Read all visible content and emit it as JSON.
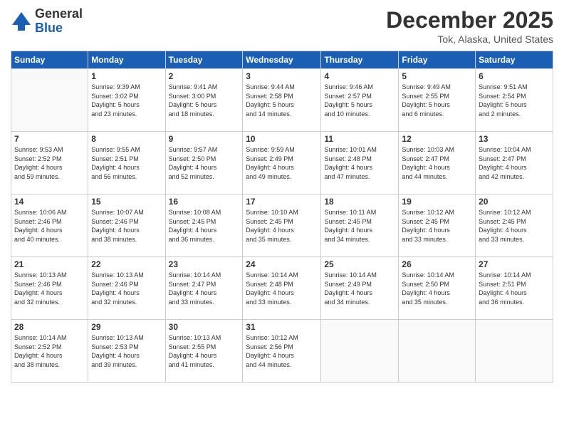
{
  "logo": {
    "general": "General",
    "blue": "Blue"
  },
  "header": {
    "month": "December 2025",
    "location": "Tok, Alaska, United States"
  },
  "weekdays": [
    "Sunday",
    "Monday",
    "Tuesday",
    "Wednesday",
    "Thursday",
    "Friday",
    "Saturday"
  ],
  "weeks": [
    [
      {
        "day": "",
        "info": ""
      },
      {
        "day": "1",
        "info": "Sunrise: 9:39 AM\nSunset: 3:02 PM\nDaylight: 5 hours\nand 23 minutes."
      },
      {
        "day": "2",
        "info": "Sunrise: 9:41 AM\nSunset: 3:00 PM\nDaylight: 5 hours\nand 18 minutes."
      },
      {
        "day": "3",
        "info": "Sunrise: 9:44 AM\nSunset: 2:58 PM\nDaylight: 5 hours\nand 14 minutes."
      },
      {
        "day": "4",
        "info": "Sunrise: 9:46 AM\nSunset: 2:57 PM\nDaylight: 5 hours\nand 10 minutes."
      },
      {
        "day": "5",
        "info": "Sunrise: 9:49 AM\nSunset: 2:55 PM\nDaylight: 5 hours\nand 6 minutes."
      },
      {
        "day": "6",
        "info": "Sunrise: 9:51 AM\nSunset: 2:54 PM\nDaylight: 5 hours\nand 2 minutes."
      }
    ],
    [
      {
        "day": "7",
        "info": "Sunrise: 9:53 AM\nSunset: 2:52 PM\nDaylight: 4 hours\nand 59 minutes."
      },
      {
        "day": "8",
        "info": "Sunrise: 9:55 AM\nSunset: 2:51 PM\nDaylight: 4 hours\nand 56 minutes."
      },
      {
        "day": "9",
        "info": "Sunrise: 9:57 AM\nSunset: 2:50 PM\nDaylight: 4 hours\nand 52 minutes."
      },
      {
        "day": "10",
        "info": "Sunrise: 9:59 AM\nSunset: 2:49 PM\nDaylight: 4 hours\nand 49 minutes."
      },
      {
        "day": "11",
        "info": "Sunrise: 10:01 AM\nSunset: 2:48 PM\nDaylight: 4 hours\nand 47 minutes."
      },
      {
        "day": "12",
        "info": "Sunrise: 10:03 AM\nSunset: 2:47 PM\nDaylight: 4 hours\nand 44 minutes."
      },
      {
        "day": "13",
        "info": "Sunrise: 10:04 AM\nSunset: 2:47 PM\nDaylight: 4 hours\nand 42 minutes."
      }
    ],
    [
      {
        "day": "14",
        "info": "Sunrise: 10:06 AM\nSunset: 2:46 PM\nDaylight: 4 hours\nand 40 minutes."
      },
      {
        "day": "15",
        "info": "Sunrise: 10:07 AM\nSunset: 2:46 PM\nDaylight: 4 hours\nand 38 minutes."
      },
      {
        "day": "16",
        "info": "Sunrise: 10:08 AM\nSunset: 2:45 PM\nDaylight: 4 hours\nand 36 minutes."
      },
      {
        "day": "17",
        "info": "Sunrise: 10:10 AM\nSunset: 2:45 PM\nDaylight: 4 hours\nand 35 minutes."
      },
      {
        "day": "18",
        "info": "Sunrise: 10:11 AM\nSunset: 2:45 PM\nDaylight: 4 hours\nand 34 minutes."
      },
      {
        "day": "19",
        "info": "Sunrise: 10:12 AM\nSunset: 2:45 PM\nDaylight: 4 hours\nand 33 minutes."
      },
      {
        "day": "20",
        "info": "Sunrise: 10:12 AM\nSunset: 2:45 PM\nDaylight: 4 hours\nand 33 minutes."
      }
    ],
    [
      {
        "day": "21",
        "info": "Sunrise: 10:13 AM\nSunset: 2:46 PM\nDaylight: 4 hours\nand 32 minutes."
      },
      {
        "day": "22",
        "info": "Sunrise: 10:13 AM\nSunset: 2:46 PM\nDaylight: 4 hours\nand 32 minutes."
      },
      {
        "day": "23",
        "info": "Sunrise: 10:14 AM\nSunset: 2:47 PM\nDaylight: 4 hours\nand 33 minutes."
      },
      {
        "day": "24",
        "info": "Sunrise: 10:14 AM\nSunset: 2:48 PM\nDaylight: 4 hours\nand 33 minutes."
      },
      {
        "day": "25",
        "info": "Sunrise: 10:14 AM\nSunset: 2:49 PM\nDaylight: 4 hours\nand 34 minutes."
      },
      {
        "day": "26",
        "info": "Sunrise: 10:14 AM\nSunset: 2:50 PM\nDaylight: 4 hours\nand 35 minutes."
      },
      {
        "day": "27",
        "info": "Sunrise: 10:14 AM\nSunset: 2:51 PM\nDaylight: 4 hours\nand 36 minutes."
      }
    ],
    [
      {
        "day": "28",
        "info": "Sunrise: 10:14 AM\nSunset: 2:52 PM\nDaylight: 4 hours\nand 38 minutes."
      },
      {
        "day": "29",
        "info": "Sunrise: 10:13 AM\nSunset: 2:53 PM\nDaylight: 4 hours\nand 39 minutes."
      },
      {
        "day": "30",
        "info": "Sunrise: 10:13 AM\nSunset: 2:55 PM\nDaylight: 4 hours\nand 41 minutes."
      },
      {
        "day": "31",
        "info": "Sunrise: 10:12 AM\nSunset: 2:56 PM\nDaylight: 4 hours\nand 44 minutes."
      },
      {
        "day": "",
        "info": ""
      },
      {
        "day": "",
        "info": ""
      },
      {
        "day": "",
        "info": ""
      }
    ]
  ]
}
